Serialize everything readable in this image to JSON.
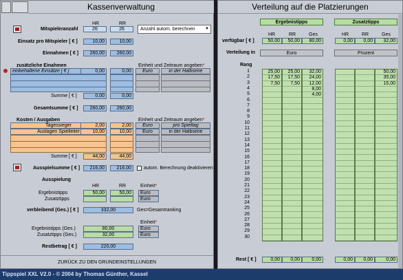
{
  "left": {
    "title": "Kassenverwaltung",
    "cols": {
      "hr": "HR",
      "rr": "RR"
    },
    "mitspieler": {
      "label": "Mitspieleranzahl",
      "hr": "26",
      "rr": "26",
      "dropdown": "Anzahl autom. berechnen"
    },
    "einsatz": {
      "label": "Einsatz pro Mitspieler [ € ]",
      "hr": "10,00",
      "rr": "10,00"
    },
    "einnahmen": {
      "label": "Einnahmen [ € ]",
      "hr": "260,00",
      "rr": "260,00"
    },
    "zusatz": {
      "label": "zusätzliche Einahmen",
      "row1": "einbehaltene Einsätze [ € ]",
      "hr": "0,00",
      "rr": "0,00",
      "unit_header": "Einheit und Zeitraum angeben",
      "unit1": "Euro",
      "period1": "in der Halbserie",
      "sum_label": "Summe [ € ]",
      "sum_hr": "0,00",
      "sum_rr": "0,00"
    },
    "gesamt": {
      "label": "Gesamtsumme [ € ]",
      "hr": "260,00",
      "rr": "260,00"
    },
    "kosten": {
      "label": "Kosten / Ausgaben",
      "unit_header": "Einheit und Zeitraum angeben",
      "rows": [
        {
          "name": "Tagessieger",
          "hr": "2,00",
          "rr": "2,00",
          "unit": "Euro",
          "period": "pro Spieltag"
        },
        {
          "name": "Auslagen Spielleiter",
          "hr": "10,00",
          "rr": "10,00",
          "unit": "Euro",
          "period": "in der Halbserie"
        }
      ],
      "sum_label": "Summe [ € ]",
      "sum_hr": "44,00",
      "sum_rr": "44,00"
    },
    "ausspielsumme": {
      "label": "Ausspielsumme [ € ]",
      "hr": "216,00",
      "rr": "216,00",
      "checkbox": "autom. Berechnung deaktivieren"
    },
    "ausspielung": {
      "label": "Ausspielung",
      "hr": "HR",
      "rr": "RR",
      "einheit": "Einheit",
      "ergebnis_label": "Ergebnistipps",
      "ergebnis_hr": "50,00",
      "ergebnis_rr": "50,00",
      "ergebnis_unit": "Euro",
      "zusatz_label": "Zusatztipps",
      "zusatz_unit": "Euro"
    },
    "verbleibend": {
      "label": "verbleibend (Ges.) [ € ]",
      "value": "332,00",
      "note": "Ges=Gesamtranking"
    },
    "ges": {
      "einheit": "Einheit",
      "ergebnis_label": "Ergebnistipps (Ges.)",
      "ergebnis_value": "80,00",
      "ergebnis_unit": "Euro",
      "zusatz_label": "Zusatztipps (Ges.)",
      "zusatz_value": "32,00",
      "zusatz_unit": "Euro"
    },
    "restbetrag": {
      "label": "Restbetrag [ € ]",
      "value": "220,00"
    },
    "back": "ZURÜCK ZU DEN GRUNDEINSTELLUNGEN"
  },
  "right": {
    "title": "Verteilung auf die Platzierungen",
    "btn_ergebnis": "Ergebnistipps",
    "btn_zusatz": "Zusatztipps",
    "cols": [
      "HR",
      "RR",
      "Ges",
      "HR",
      "RR",
      "Ges"
    ],
    "verfuegbar": {
      "label": "verfügbar [ € ]",
      "values": [
        "50,00",
        "50,00",
        "80,00",
        "0,00",
        "0,00",
        "32,00"
      ]
    },
    "verteilung": {
      "label": "Verteilung in",
      "left": "Euro",
      "right": "Prozent"
    },
    "rang_label": "Rang",
    "rows": [
      [
        "25,00",
        "25,00",
        "32,00",
        "",
        "",
        "50,00"
      ],
      [
        "17,50",
        "17,50",
        "24,00",
        "",
        "",
        "35,00"
      ],
      [
        "7,50",
        "7,50",
        "12,00",
        "",
        "",
        "15,00"
      ],
      [
        "",
        "",
        "8,00",
        "",
        "",
        ""
      ],
      [
        "",
        "",
        "4,00",
        "",
        "",
        ""
      ]
    ],
    "rest": {
      "label": "Rest [ € ]",
      "values": [
        "0,00",
        "0,00",
        "0,00",
        "0,00",
        "0,00",
        "0,00"
      ]
    }
  },
  "footer": "Tippspiel XXL V2.0 - © 2004 by Thomas Günther, Kassel"
}
